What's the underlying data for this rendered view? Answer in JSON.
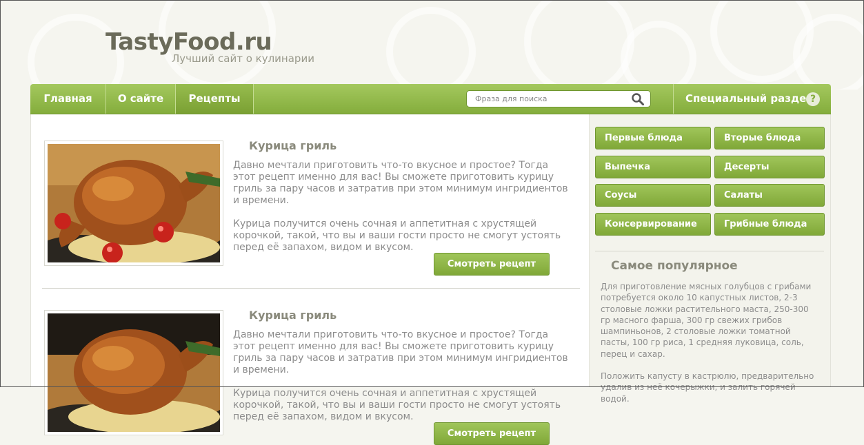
{
  "site": {
    "title": "TastyFood.ru",
    "subtitle": "Лучший сайт о кулинарии"
  },
  "nav": {
    "items": [
      {
        "label": "Главная",
        "active": false
      },
      {
        "label": "О сайте",
        "active": false
      },
      {
        "label": "Рецепты",
        "active": true
      }
    ],
    "search_placeholder": "Фраза для поиска",
    "special_label": "Специальный раздел",
    "help_glyph": "?"
  },
  "posts": [
    {
      "title": "Курица гриль",
      "paragraphs": [
        "Давно мечтали приготовить что-то вкусное и простое? Тогда этот рецепт именно для вас! Вы сможете приготовить курицу гриль за пару часов и затратив при этом минимум ингридиентов и времени.",
        "Курица получится очень сочная и аппетитная с хрустящей корочкой, такой, что вы и ваши гости просто не смогут устоять перед её запахом, видом и вкусом."
      ],
      "button_label": "Смотреть рецепт"
    },
    {
      "title": "Курица гриль",
      "paragraphs": [
        "Давно мечтали приготовить что-то вкусное и простое? Тогда этот рецепт именно для вас! Вы сможете приготовить курицу гриль за пару часов и затратив при этом минимум ингридиентов и времени.",
        "Курица получится очень сочная и аппетитная с хрустящей корочкой, такой, что вы и ваши гости просто не смогут устоять перед её запахом, видом и вкусом."
      ],
      "button_label": "Смотреть рецепт"
    }
  ],
  "categories": [
    "Первые блюда",
    "Вторые блюда",
    "Выпечка",
    "Десерты",
    "Соусы",
    "Салаты",
    "Консервирование",
    "Грибные блюда"
  ],
  "popular": {
    "title": "Самое популярное",
    "paragraphs": [
      "Для приготовление мясных голубцов с грибами потребуется около 10 капустных листов, 2-3 столовые ложки растительного маста, 250-300 гр масного фарша, 300 гр свежих грибов шампиньонов, 2 столовые ложки томатной пасты, 100 гр риса, 1 средняя луковица, соль, перец и сахар.",
      "Положить капусту в кастрюлю, предварительно удалив из неё кочерыжки, и залить горячей водой."
    ]
  },
  "colors": {
    "accent_green": "#8db545",
    "text_gray": "#8c8c8c",
    "background": "#f5f5ef"
  },
  "icons": {
    "search": "magnifier-icon",
    "help": "question-circle-icon"
  }
}
